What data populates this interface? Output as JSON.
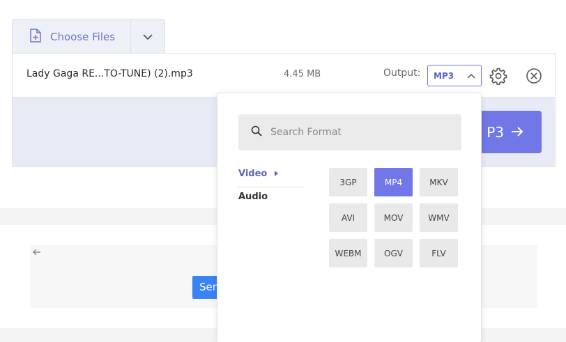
{
  "uploader": {
    "choose_files_label": "Choose Files"
  },
  "file": {
    "name": "Lady Gaga RE...TO-TUNE) (2).mp3",
    "size": "4.45 MB",
    "output_label": "Output:",
    "output_value": "MP3"
  },
  "convert": {
    "label": "P3"
  },
  "lower": {
    "send_label": "Sen"
  },
  "format_picker": {
    "search_placeholder": "Search Format",
    "categories": [
      "Video",
      "Audio"
    ],
    "selected_category": "Video",
    "formats": [
      "3GP",
      "MP4",
      "MKV",
      "AVI",
      "MOV",
      "WMV",
      "WEBM",
      "OGV",
      "FLV"
    ],
    "selected_format": "MP4"
  },
  "colors": {
    "accent": "#7177e6",
    "accent_text": "#5c63c4",
    "send_blue": "#3b82f6"
  }
}
